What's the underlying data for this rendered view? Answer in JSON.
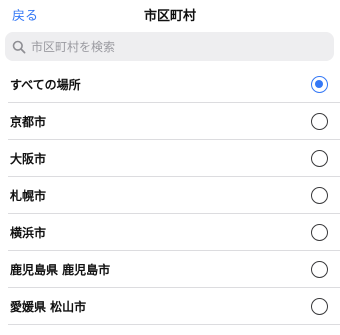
{
  "header": {
    "back_label": "戻る",
    "title": "市区町村"
  },
  "search": {
    "placeholder": "市区町村を検索",
    "value": "",
    "icon": "search-icon"
  },
  "colors": {
    "accent": "#3478f6",
    "search_bg": "#eeeef0",
    "divider": "#dcdcdf"
  },
  "locations": [
    {
      "label": "すべての場所",
      "selected": true
    },
    {
      "label": "京都市",
      "selected": false
    },
    {
      "label": "大阪市",
      "selected": false
    },
    {
      "label": "札幌市",
      "selected": false
    },
    {
      "label": "横浜市",
      "selected": false
    },
    {
      "label": "鹿児島県 鹿児島市",
      "selected": false
    },
    {
      "label": "愛媛県 松山市",
      "selected": false
    }
  ]
}
